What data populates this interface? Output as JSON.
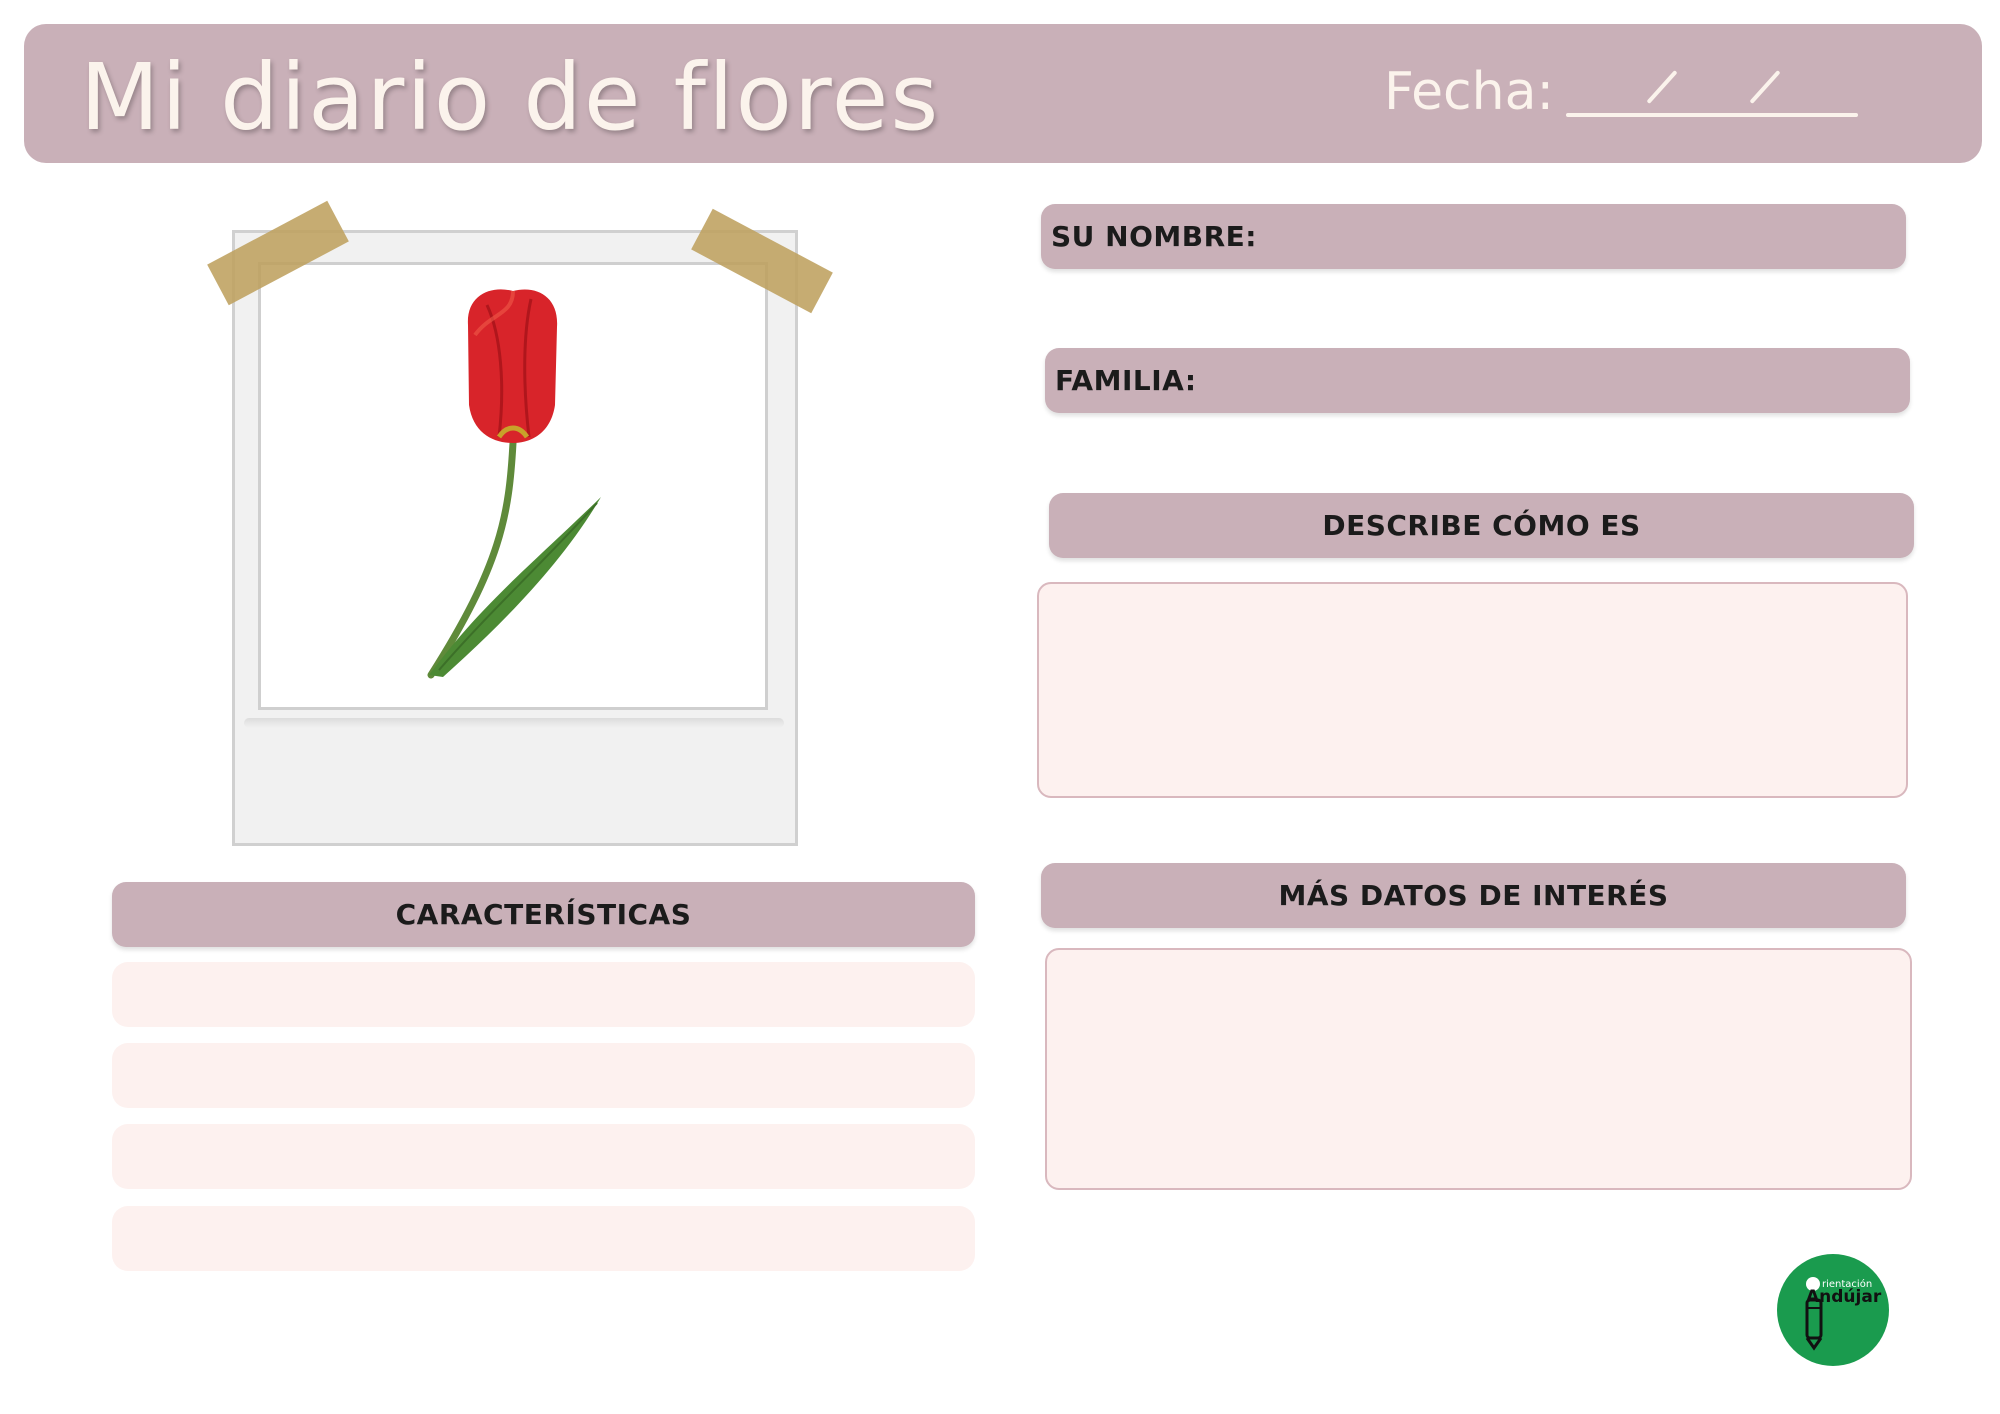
{
  "header": {
    "title": "Mi diario de flores",
    "date_label": "Fecha:"
  },
  "fields": {
    "name_label": "SU NOMBRE:",
    "family_label": "FAMILIA:",
    "describe_label": "DESCRIBE CÓMO ES",
    "more_label": "MÁS DATOS DE INTERÉS",
    "characteristics_label": "CARACTERÍSTICAS"
  },
  "logo": {
    "line1": "rientación",
    "line2": "Andújar"
  },
  "image": {
    "subject": "tulip-photo"
  },
  "colors": {
    "accent": "#c9b0b8",
    "box_fill": "#fdf1ef",
    "logo_green": "#1a9b4e",
    "tulip_red": "#d8242a"
  }
}
